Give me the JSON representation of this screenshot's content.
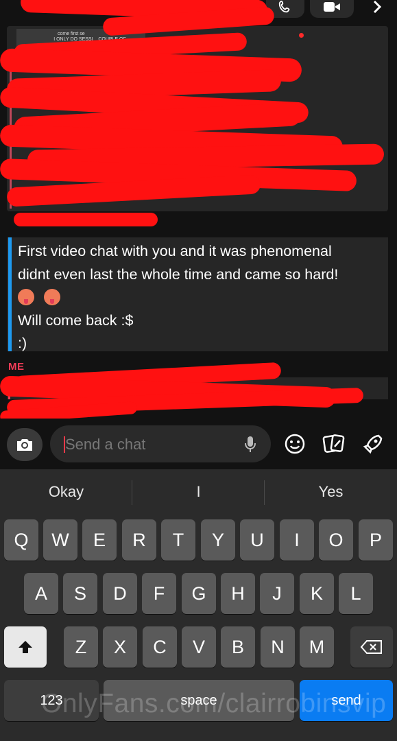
{
  "thumbnail": {
    "line1": "come first se",
    "line2": "I ONLY DO SESSI    COUPLE OF\nMONTHS SO"
  },
  "message": {
    "text": "First video chat with you and it was phenomenal\ndidnt even last the whole time and came so hard!\n\nWill come back :$\n:)"
  },
  "me_label": "ME",
  "input": {
    "placeholder": "Send a chat"
  },
  "keyboard": {
    "suggestions": [
      "Okay",
      "I",
      "Yes"
    ],
    "row1": [
      "Q",
      "W",
      "E",
      "R",
      "T",
      "Y",
      "U",
      "I",
      "O",
      "P"
    ],
    "row2": [
      "A",
      "S",
      "D",
      "F",
      "G",
      "H",
      "J",
      "K",
      "L"
    ],
    "row3": [
      "Z",
      "X",
      "C",
      "V",
      "B",
      "N",
      "M"
    ],
    "numbers_key": "123",
    "space_key": "space",
    "send_key": "send"
  },
  "icons": [
    "phone-icon",
    "video-icon",
    "chevron-right-icon",
    "camera-icon",
    "microphone-icon",
    "smiley-icon",
    "stickers-icon",
    "rocket-icon",
    "shift-icon",
    "backspace-icon",
    "emoji-icon"
  ],
  "colors": {
    "accent_blue": "#1e9af0",
    "me_red": "#f23c57",
    "send_blue": "#0a7cf2",
    "redaction": "#ff1111"
  },
  "watermark": "OnlyFans.com/clairrobinsvip"
}
